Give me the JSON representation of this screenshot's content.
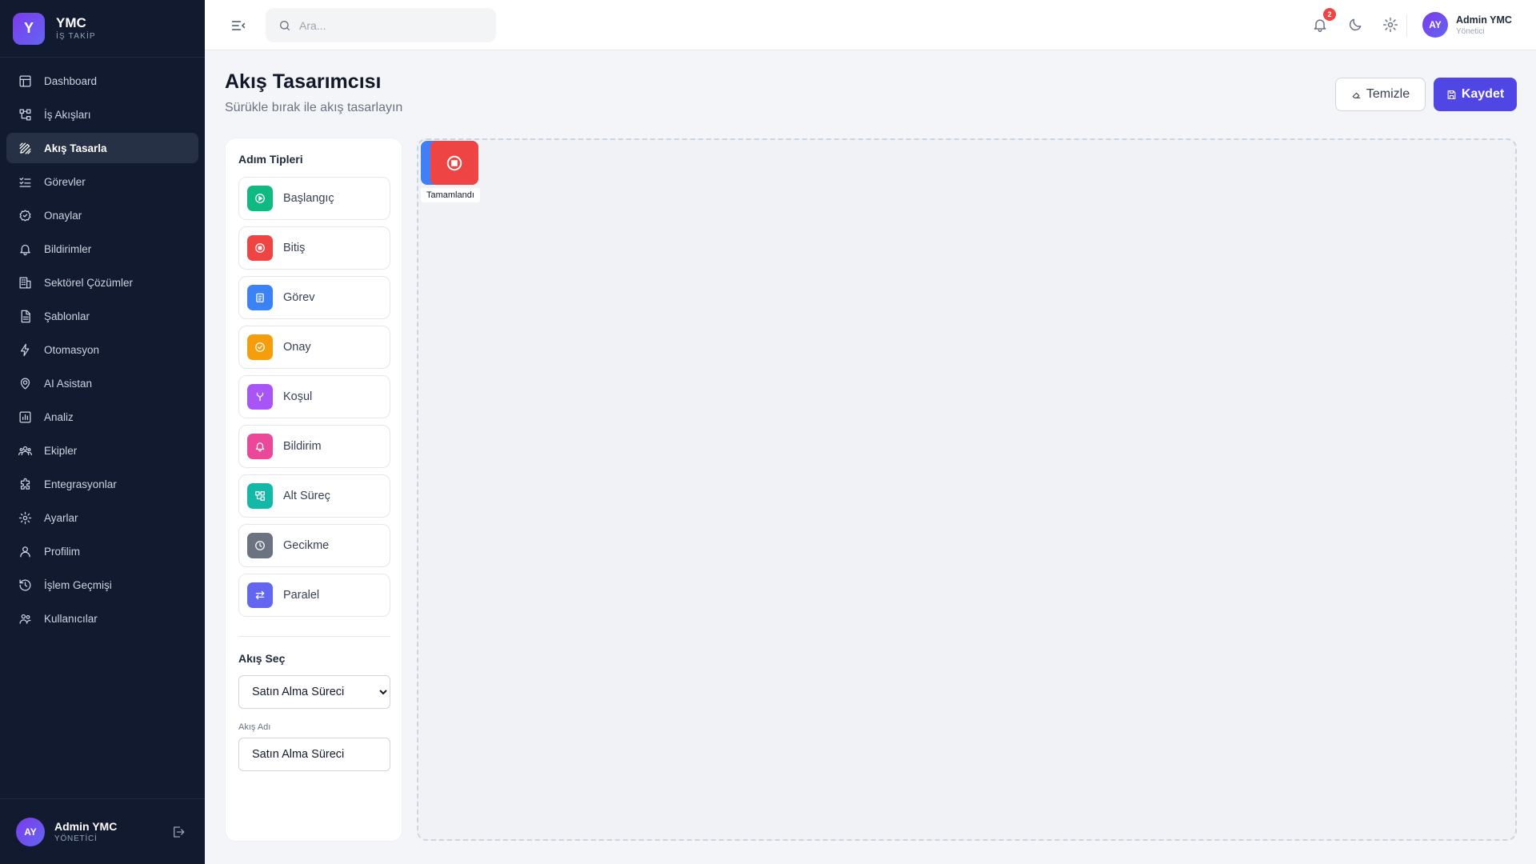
{
  "brand": {
    "logo_letter": "Y",
    "name": "YMC",
    "subtitle": "İŞ TAKİP"
  },
  "sidebar": {
    "items": [
      {
        "label": "Dashboard",
        "icon": "dashboard-icon"
      },
      {
        "label": "İş Akışları",
        "icon": "workflow-icon"
      },
      {
        "label": "Akış Tasarla",
        "icon": "design-icon",
        "active": true
      },
      {
        "label": "Görevler",
        "icon": "tasks-icon"
      },
      {
        "label": "Onaylar",
        "icon": "approval-icon"
      },
      {
        "label": "Bildirimler",
        "icon": "bell-icon"
      },
      {
        "label": "Sektörel Çözümler",
        "icon": "building-icon"
      },
      {
        "label": "Şablonlar",
        "icon": "document-icon"
      },
      {
        "label": "Otomasyon",
        "icon": "bolt-icon"
      },
      {
        "label": "AI Asistan",
        "icon": "brain-icon"
      },
      {
        "label": "Analiz",
        "icon": "chart-icon"
      },
      {
        "label": "Ekipler",
        "icon": "team-icon"
      },
      {
        "label": "Entegrasyonlar",
        "icon": "puzzle-icon"
      },
      {
        "label": "Ayarlar",
        "icon": "gear-icon"
      },
      {
        "label": "Profilim",
        "icon": "user-icon"
      },
      {
        "label": "İşlem Geçmişi",
        "icon": "history-icon"
      },
      {
        "label": "Kullanıcılar",
        "icon": "users-icon"
      }
    ],
    "footer": {
      "initials": "AY",
      "name": "Admin YMC",
      "role": "YÖNETİCİ"
    }
  },
  "topbar": {
    "search_placeholder": "Ara...",
    "notification_count": "2",
    "user": {
      "initials": "AY",
      "name": "Admin YMC",
      "role": "Yönetici"
    }
  },
  "page": {
    "title": "Akış Tasarımcısı",
    "subtitle": "Sürükle bırak ile akış tasarlayın",
    "clear_label": "Temizle",
    "save_label": "Kaydet"
  },
  "palette": {
    "title": "Adım Tipleri",
    "steps": [
      {
        "label": "Başlangıç",
        "icon": "play-circle-icon",
        "color": "#10b981"
      },
      {
        "label": "Bitiş",
        "icon": "stop-circle-icon",
        "color": "#ef4444"
      },
      {
        "label": "Görev",
        "icon": "clipboard-icon",
        "color": "#3b82f6"
      },
      {
        "label": "Onay",
        "icon": "check-circle-icon",
        "color": "#f59e0b"
      },
      {
        "label": "Koşul",
        "icon": "branch-icon",
        "color": "#a855f7"
      },
      {
        "label": "Bildirim",
        "icon": "bell-icon",
        "color": "#ec4899"
      },
      {
        "label": "Alt Süreç",
        "icon": "subprocess-icon",
        "color": "#14b8a6"
      },
      {
        "label": "Gecikme",
        "icon": "clock-icon",
        "color": "#6b7280"
      },
      {
        "label": "Paralel",
        "icon": "arrows-icon",
        "color": "#6366f1"
      }
    ],
    "flow_select_title": "Akış Seç",
    "flow_selected": "Satın Alma Süreci",
    "flow_name_label": "Akış Adı",
    "flow_name_value": "Satın Alma Süreci"
  },
  "canvas": {
    "nodes": [
      {
        "label": "Tamamlandı",
        "type": "Bitiş",
        "icon": "stop-circle-icon",
        "color": "#ef4444"
      }
    ]
  }
}
